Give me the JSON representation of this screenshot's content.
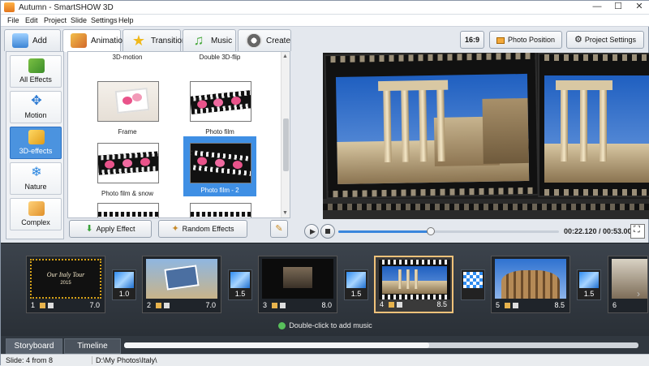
{
  "window": {
    "title": "Autumn - SmartSHOW 3D",
    "min": "—",
    "max": "☐",
    "close": "✕"
  },
  "menu": [
    "File",
    "Edit",
    "Project",
    "Slide",
    "Settings",
    "Help"
  ],
  "tabs": [
    {
      "label": "Add",
      "icon": "add-photo-icon"
    },
    {
      "label": "Animation",
      "icon": "animation-icon",
      "active": true
    },
    {
      "label": "Transitions",
      "icon": "star-icon"
    },
    {
      "label": "Music",
      "icon": "music-note-icon"
    },
    {
      "label": "Create",
      "icon": "film-reel-icon"
    }
  ],
  "right_toolbar": {
    "aspect": "16:9",
    "photo_position": "Photo Position",
    "project_settings": "Project Settings"
  },
  "categories": [
    {
      "label": "All Effects",
      "icon": "puzzle-icon"
    },
    {
      "label": "Motion",
      "icon": "move-arrows-icon"
    },
    {
      "label": "3D-effects",
      "icon": "cube-icon",
      "active": true
    },
    {
      "label": "Nature",
      "icon": "snowflake-icon"
    },
    {
      "label": "Complex",
      "icon": "stack-icon"
    }
  ],
  "effects": {
    "row0": [
      "3D-motion",
      "Double 3D-flip"
    ],
    "row1": [
      "Frame",
      "Photo film"
    ],
    "row2": [
      "Photo film & snow",
      "Photo film - 2"
    ],
    "selected": "Photo film - 2"
  },
  "effect_buttons": {
    "apply": "Apply Effect",
    "random": "Random Effects"
  },
  "player": {
    "time": "00:22.120 / 00:53.000",
    "progress": 0.42
  },
  "slides": [
    {
      "num": "1",
      "duration": "7.0",
      "title": "Our Italy Tour",
      "year": "2015"
    },
    {
      "num": "2",
      "duration": "7.0"
    },
    {
      "num": "3",
      "duration": "8.0"
    },
    {
      "num": "4",
      "duration": "8.5",
      "selected": true
    },
    {
      "num": "5",
      "duration": "8.5"
    },
    {
      "num": "6",
      "duration": ""
    }
  ],
  "transitions": [
    "1.0",
    "1.5",
    "1.5",
    "",
    "1.5"
  ],
  "music_hint": "Double-click to add music",
  "bottom_tabs": {
    "storyboard": "Storyboard",
    "timeline": "Timeline"
  },
  "status": {
    "slide": "Slide: 4 from 8",
    "path": "D:\\My Photos\\Italy\\"
  }
}
